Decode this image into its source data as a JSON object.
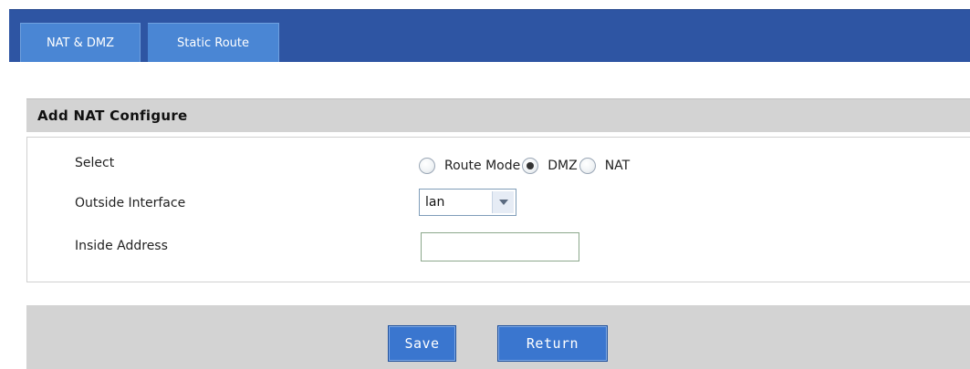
{
  "tabs": [
    {
      "label": "NAT & DMZ"
    },
    {
      "label": "Static Route"
    }
  ],
  "section": {
    "title": "Add NAT Configure"
  },
  "form": {
    "select": {
      "label": "Select",
      "options": [
        {
          "label": "Route Mode",
          "checked": false
        },
        {
          "label": "DMZ",
          "checked": true
        },
        {
          "label": "NAT",
          "checked": false
        }
      ]
    },
    "outside_interface": {
      "label": "Outside Interface",
      "value": "lan"
    },
    "inside_address": {
      "label": "Inside Address",
      "value": ""
    }
  },
  "buttons": {
    "save": "Save",
    "return": "Return"
  },
  "colors": {
    "tabbar": "#2e55a3",
    "tab": "#4a86d4",
    "section_header": "#d3d3d3",
    "button": "#3a76cf"
  },
  "icons": {
    "dropdown": "chevron-down-icon"
  }
}
